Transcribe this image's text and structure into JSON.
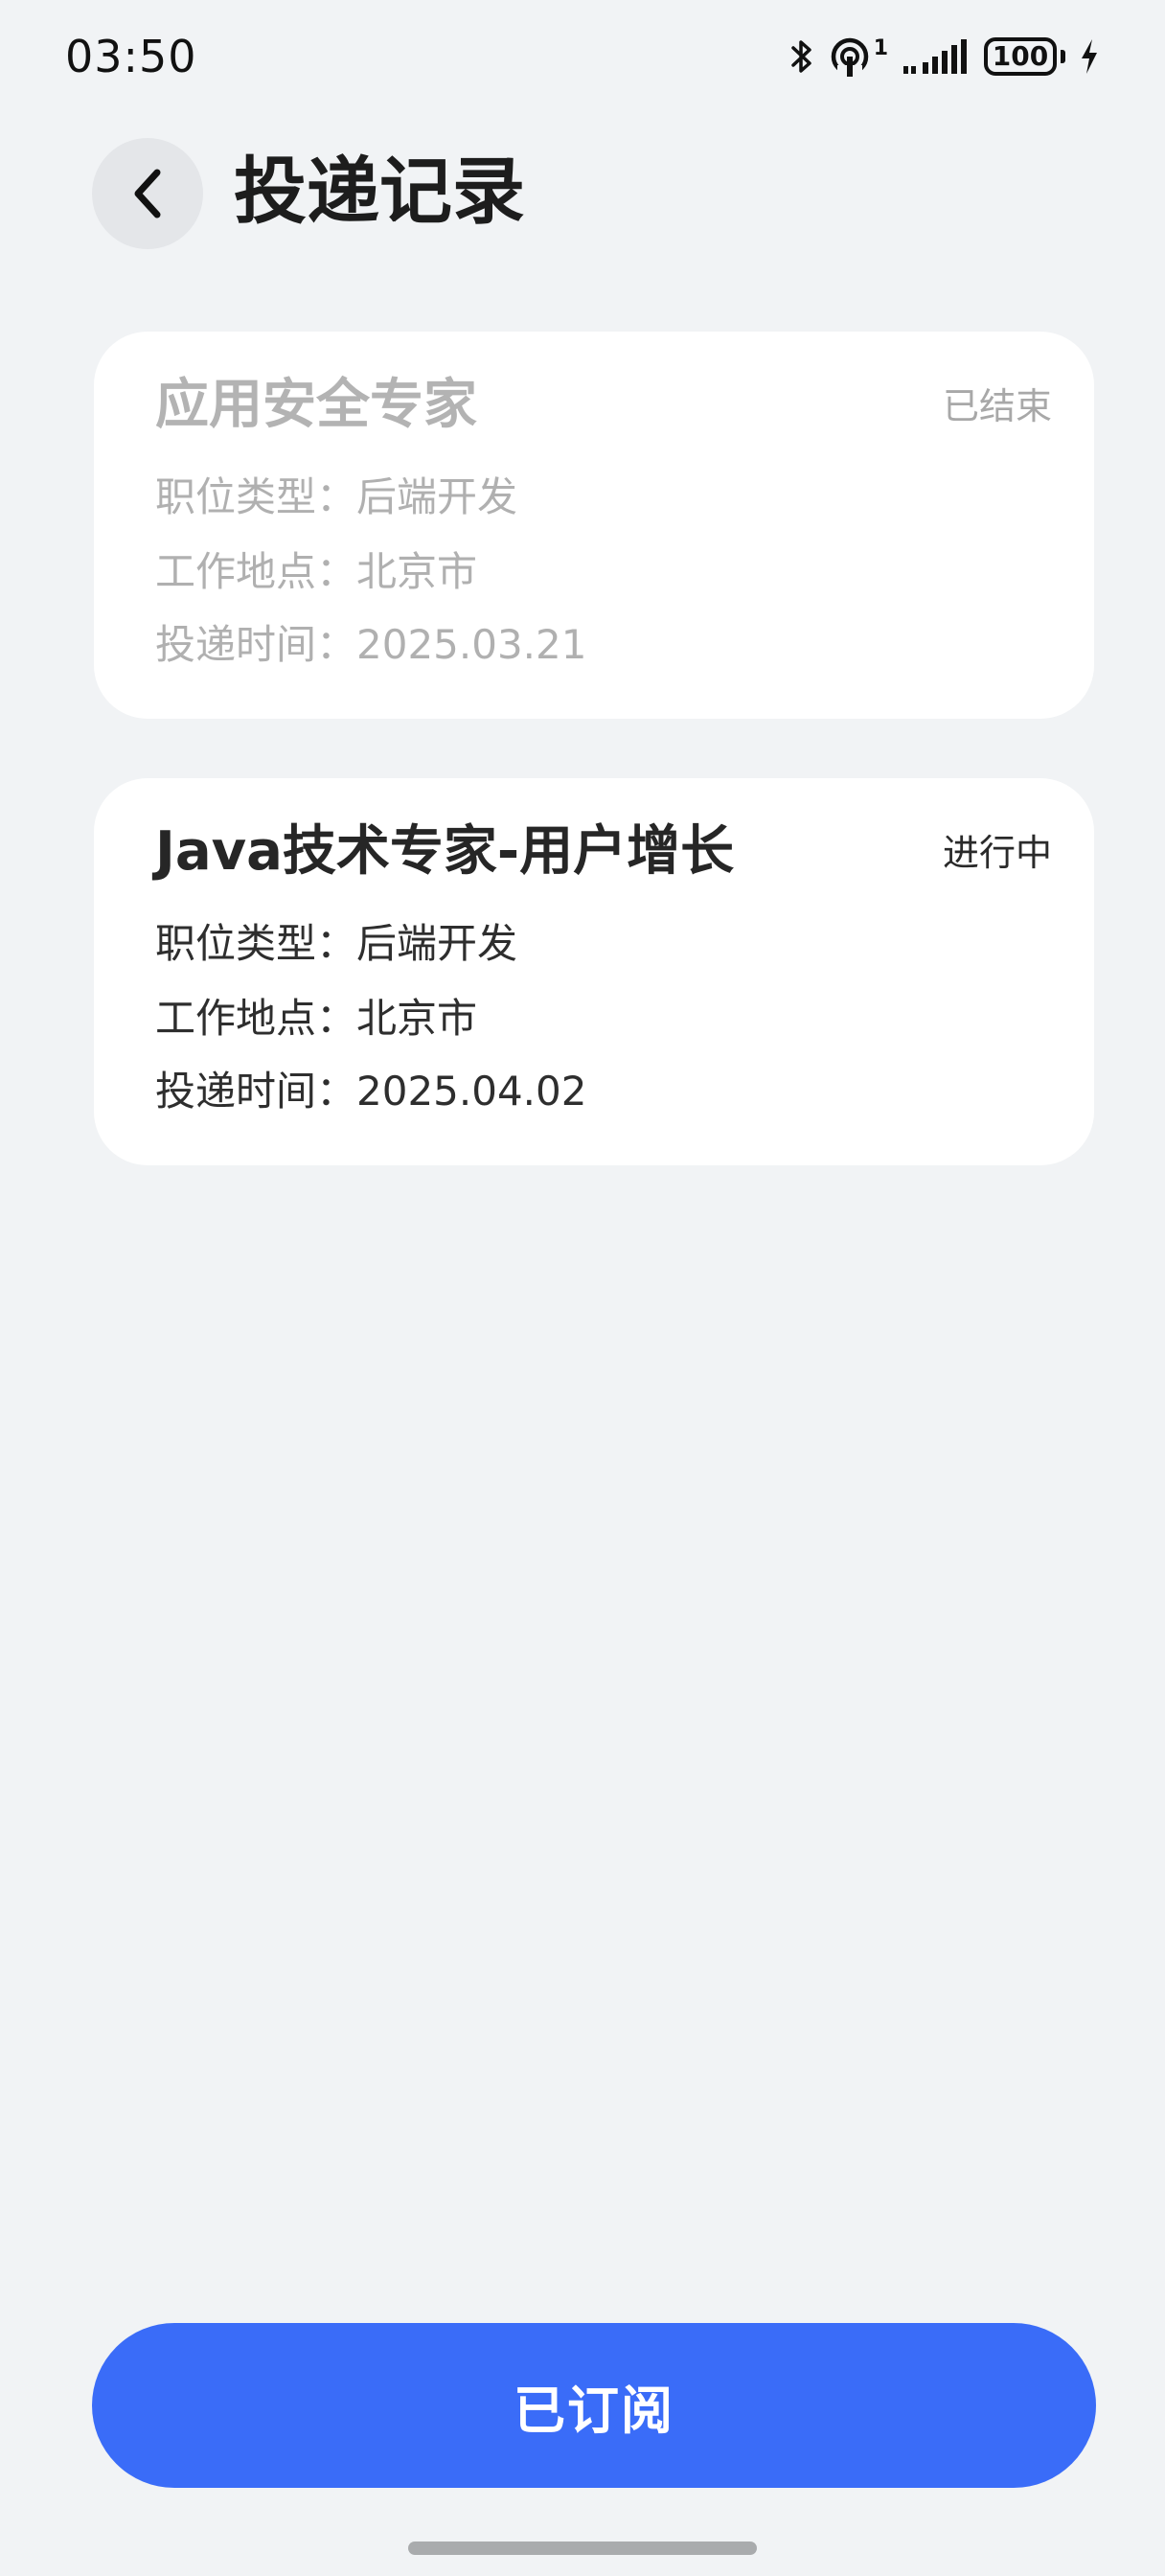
{
  "status_bar": {
    "time": "03:50",
    "hotspot_count": "1",
    "battery": "100",
    "icons": [
      "bluetooth-icon",
      "hotspot-icon",
      "signal-icon",
      "battery-icon",
      "charging-icon"
    ]
  },
  "header": {
    "title": "投递记录",
    "back_icon": "chevron-left-icon"
  },
  "records": [
    {
      "title": "应用安全专家",
      "status": "已结束",
      "job_type": "职位类型：后端开发",
      "location": "工作地点：北京市",
      "date": "投递时间：2025.03.21"
    },
    {
      "title": "Java技术专家-用户增长",
      "status": "进行中",
      "job_type": "职位类型：后端开发",
      "location": "工作地点：北京市",
      "date": "投递时间：2025.04.02"
    }
  ],
  "footer": {
    "button_label": "已订阅"
  },
  "colors": {
    "background": "#f1f3f5",
    "card": "#ffffff",
    "accent": "#3a6cf8",
    "muted_text": "#b0b0b0"
  }
}
